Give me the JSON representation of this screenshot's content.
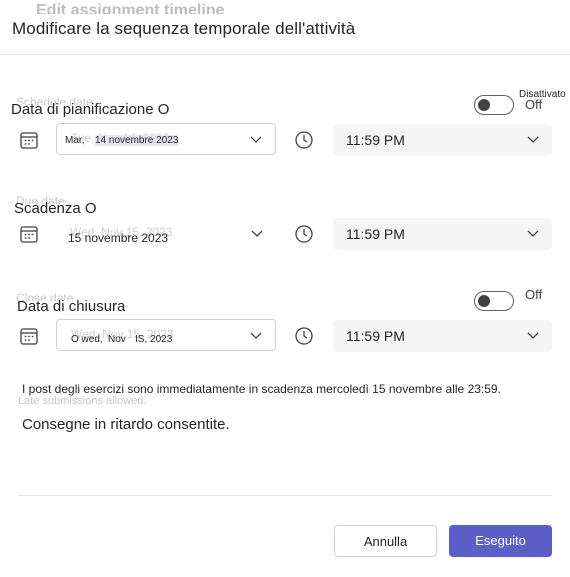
{
  "header": {
    "title": "Modificare la sequenza temporale dell'attività"
  },
  "schedule": {
    "label": "Data di pianificazione O",
    "toggle_state": "Off",
    "toggle_caption": "Disattivato",
    "date_prefix": "Mar,",
    "date_value": "14 novembre 2023",
    "time_value": "11:59 PM"
  },
  "due": {
    "label": "Scadenza O",
    "date_value": "15 novembre 2023",
    "time_value": "11:59 PM"
  },
  "close": {
    "label": "Data di chiusura",
    "toggle_state": "Off",
    "date_part1": "O wed,",
    "date_part2": "Nov",
    "date_part3": "IS, 2023",
    "time_value": "11:59 PM"
  },
  "note": "I post degli esercizi sono immediatamente in scadenza mercoledì 15 novembre alle 23:59.",
  "late_submissions": "Consegne in ritardo consentite.",
  "footer": {
    "cancel_label": "Annulla",
    "done_label": "Eseguito"
  },
  "colors": {
    "primary": "#5b5fc7",
    "field_fill": "#f5f5f5",
    "border": "#d1d1d1"
  },
  "icons": {
    "calendar": "calendar-icon",
    "clock": "clock-icon",
    "chevron": "chevron-down-icon"
  }
}
